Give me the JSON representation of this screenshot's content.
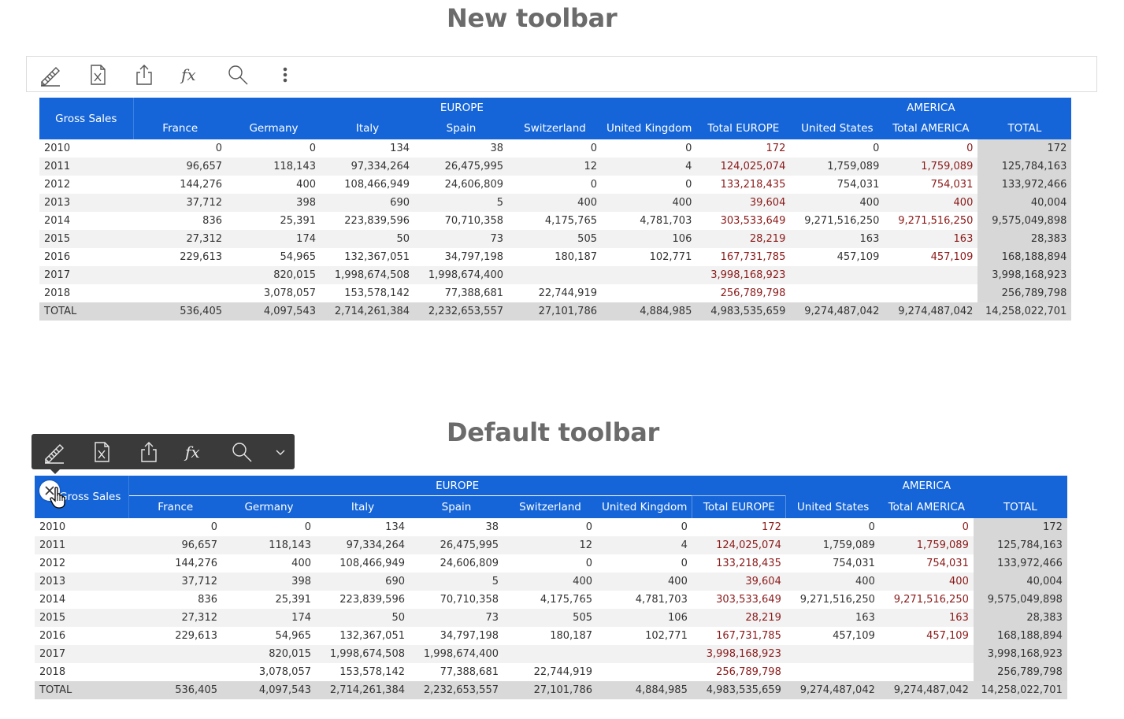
{
  "titles": {
    "new_toolbar": "New toolbar",
    "default_toolbar": "Default toolbar"
  },
  "toolbar_new": {
    "items": [
      {
        "icon": "pencil-ruler-icon"
      },
      {
        "icon": "excel-export-icon"
      },
      {
        "icon": "share-export-icon"
      },
      {
        "icon": "formula-fx-icon",
        "label": "fx"
      },
      {
        "icon": "search-icon"
      },
      {
        "icon": "more-vertical-icon"
      }
    ]
  },
  "toolbar_default": {
    "items": [
      {
        "icon": "pencil-ruler-icon"
      },
      {
        "icon": "excel-export-icon"
      },
      {
        "icon": "share-export-icon"
      },
      {
        "icon": "formula-fx-icon",
        "label": "fx"
      },
      {
        "icon": "search-icon"
      },
      {
        "icon": "chevron-down-icon"
      }
    ]
  },
  "colors": {
    "header_bg": "#1565d8",
    "subtotal_text": "#8b1a1a",
    "total_col_bg": "#d7d7d7",
    "dark_toolbar": "#3a3a3a"
  },
  "table": {
    "group_headers": {
      "europe": "EUROPE",
      "america": "AMERICA"
    },
    "row_header": "Gross Sales",
    "columns": [
      "France",
      "Germany",
      "Italy",
      "Spain",
      "Switzerland",
      "United Kingdom",
      "Total EUROPE",
      "United States",
      "Total AMERICA",
      "TOTAL"
    ],
    "rows": [
      {
        "label": "2010",
        "values": [
          "0",
          "0",
          "134",
          "38",
          "0",
          "0",
          "172",
          "0",
          "0",
          "172"
        ]
      },
      {
        "label": "2011",
        "values": [
          "96,657",
          "118,143",
          "97,334,264",
          "26,475,995",
          "12",
          "4",
          "124,025,074",
          "1,759,089",
          "1,759,089",
          "125,784,163"
        ]
      },
      {
        "label": "2012",
        "values": [
          "144,276",
          "400",
          "108,466,949",
          "24,606,809",
          "0",
          "0",
          "133,218,435",
          "754,031",
          "754,031",
          "133,972,466"
        ]
      },
      {
        "label": "2013",
        "values": [
          "37,712",
          "398",
          "690",
          "5",
          "400",
          "400",
          "39,604",
          "400",
          "400",
          "40,004"
        ]
      },
      {
        "label": "2014",
        "values": [
          "836",
          "25,391",
          "223,839,596",
          "70,710,358",
          "4,175,765",
          "4,781,703",
          "303,533,649",
          "9,271,516,250",
          "9,271,516,250",
          "9,575,049,898"
        ]
      },
      {
        "label": "2015",
        "values": [
          "27,312",
          "174",
          "50",
          "73",
          "505",
          "106",
          "28,219",
          "163",
          "163",
          "28,383"
        ]
      },
      {
        "label": "2016",
        "values": [
          "229,613",
          "54,965",
          "132,367,051",
          "34,797,198",
          "180,187",
          "102,771",
          "167,731,785",
          "457,109",
          "457,109",
          "168,188,894"
        ]
      },
      {
        "label": "2017",
        "values": [
          "",
          "820,015",
          "1,998,674,508",
          "1,998,674,400",
          "",
          "",
          "3,998,168,923",
          "",
          "",
          "3,998,168,923"
        ]
      },
      {
        "label": "2018",
        "values": [
          "",
          "3,078,057",
          "153,578,142",
          "77,388,681",
          "22,744,919",
          "",
          "256,789,798",
          "",
          "",
          "256,789,798"
        ]
      },
      {
        "label": "TOTAL",
        "values": [
          "536,405",
          "4,097,543",
          "2,714,261,384",
          "2,232,653,557",
          "27,101,786",
          "4,884,985",
          "4,983,535,659",
          "9,274,487,042",
          "9,274,487,042",
          "14,258,022,701"
        ]
      }
    ]
  }
}
